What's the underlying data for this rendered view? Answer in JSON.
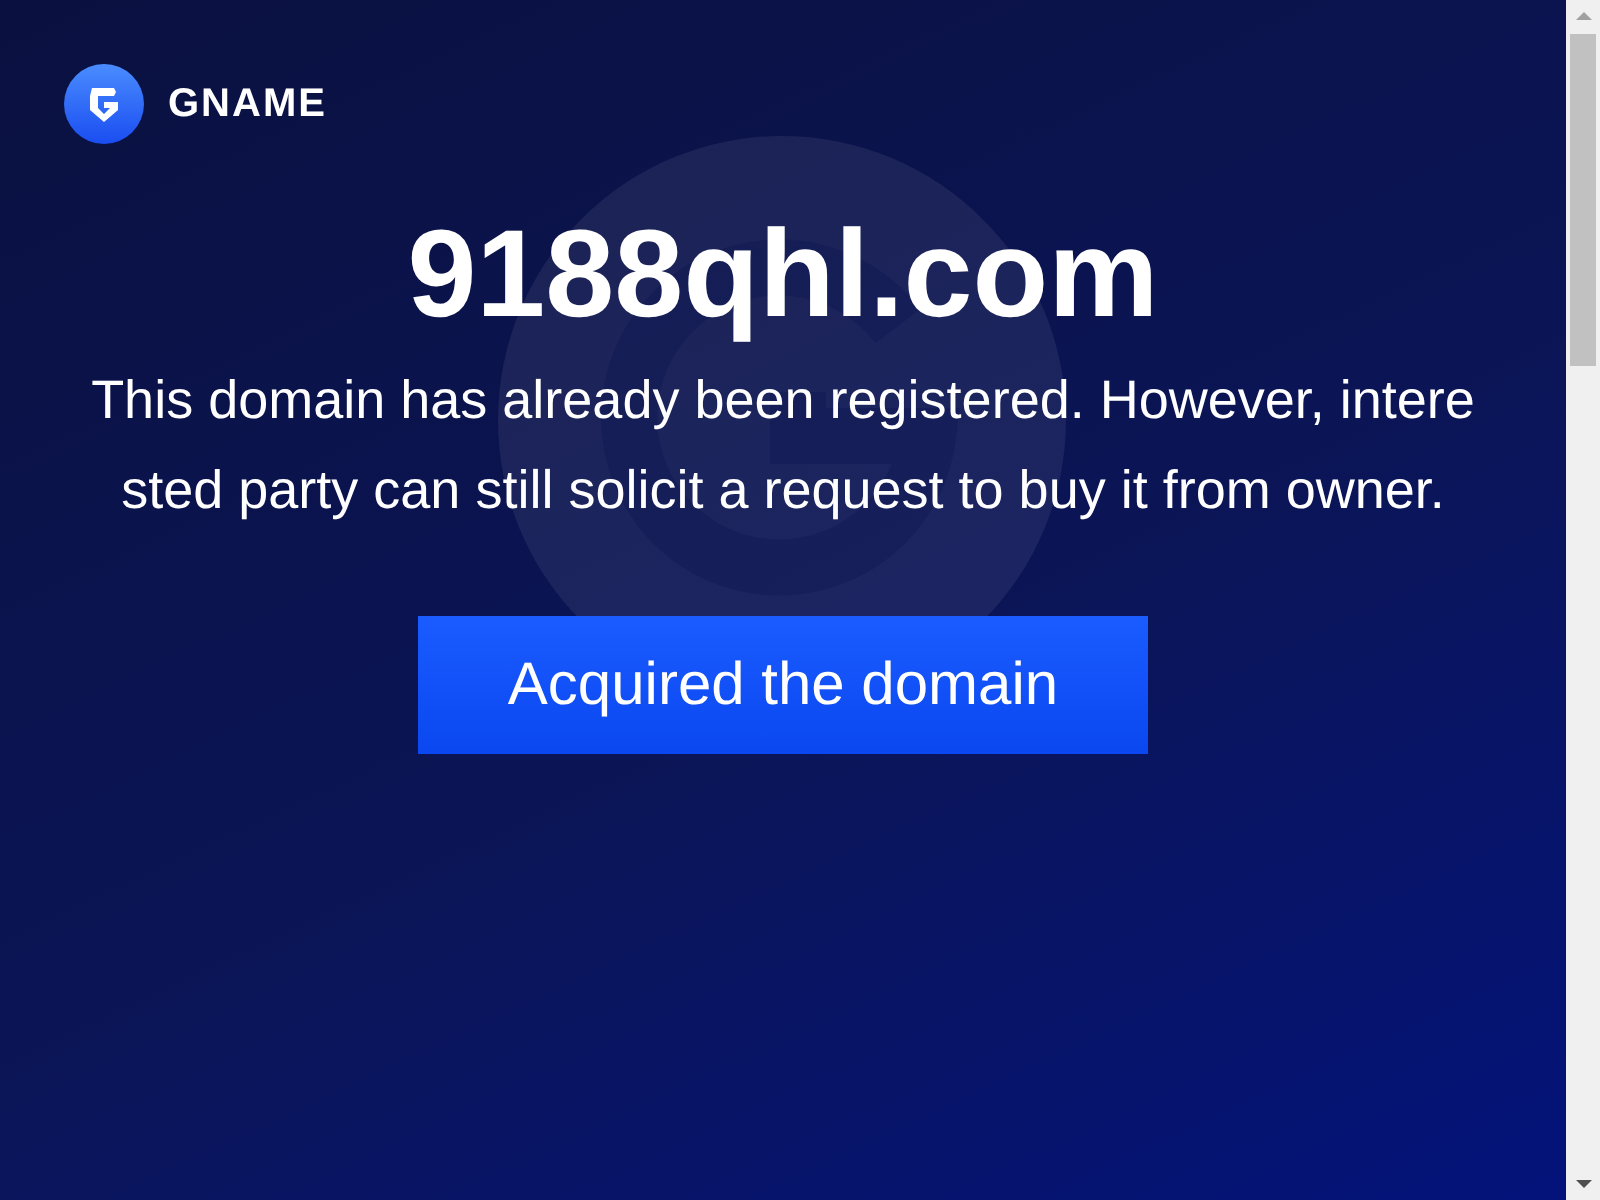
{
  "header": {
    "brand": "GNAME"
  },
  "domain": "9188qhl.com",
  "message": "This domain has already been registered. However, interested party can still solicit a request to buy it from owner.",
  "button": {
    "label": "Acquired the domain"
  }
}
